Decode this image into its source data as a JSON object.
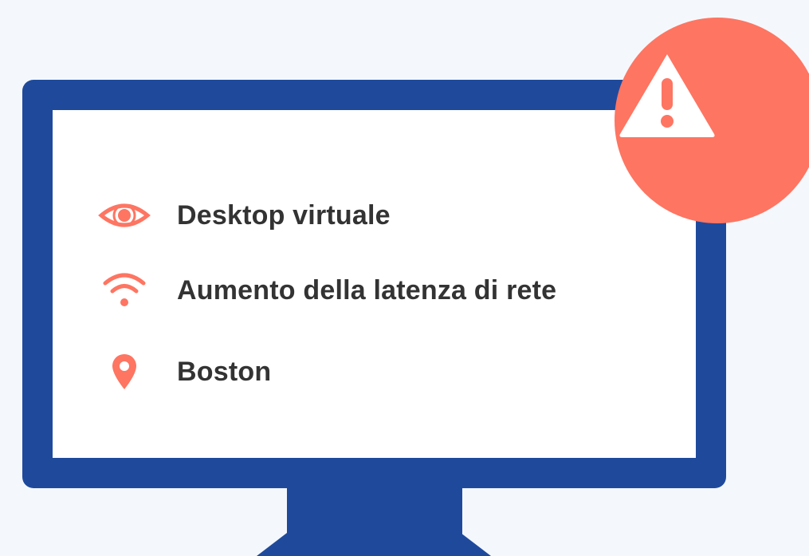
{
  "colors": {
    "background": "#f4f8fc",
    "monitor_frame": "#1f4a9c",
    "screen": "#ffffff",
    "accent": "#fe7562",
    "text": "#333333",
    "icon_on_badge": "#ffffff"
  },
  "items": [
    {
      "icon": "eye-icon",
      "label": "Desktop virtuale"
    },
    {
      "icon": "wifi-icon",
      "label": "Aumento della latenza di rete"
    },
    {
      "icon": "location-pin-icon",
      "label": "Boston"
    }
  ],
  "alert": {
    "icon": "warning-triangle-icon"
  }
}
